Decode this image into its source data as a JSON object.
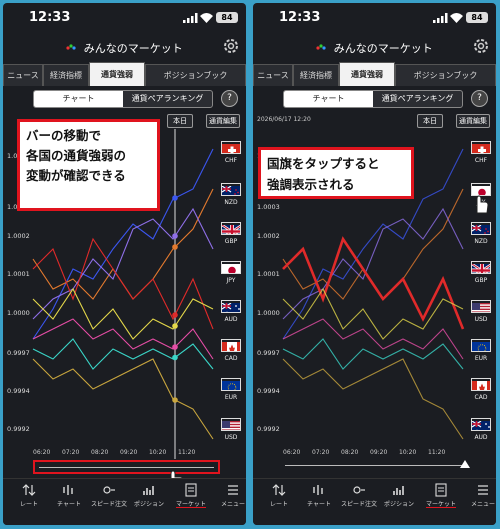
{
  "status": {
    "time": "12:33",
    "battery": "84"
  },
  "app_title": "みんなのマーケット",
  "tabs": [
    "ニュース",
    "経済指標",
    "通貨強弱",
    "ポジションブック"
  ],
  "segment": {
    "chart": "チャート",
    "ranking": "通貨ペアランキング"
  },
  "help_label": "?",
  "toolbar": {
    "today": "本日",
    "edit": "通貨編集"
  },
  "right_datestamp": "2026/06/17 12:20",
  "y_ticks": [
    "1.0005",
    "1.0004",
    "1.0003",
    "1.0002",
    "1.0001",
    "1.0000",
    "0.9997",
    "0.9994",
    "0.9992"
  ],
  "x_ticks": [
    "06:20",
    "07:20",
    "08:20",
    "09:20",
    "10:20",
    "11:20"
  ],
  "currencies": {
    "left": [
      "CHF",
      "NZD",
      "GBP",
      "JPY",
      "AUD",
      "CAD",
      "EUR",
      "USD"
    ],
    "right": [
      "CHF",
      "JPY",
      "NZD",
      "GBP",
      "USD",
      "EUR",
      "CAD",
      "AUD"
    ]
  },
  "callout_left": "バーの移動で\n各国の通貨強弱の\n変動が確認できる",
  "callout_right": "国旗をタップすると\n強調表示される",
  "nav": [
    "レート",
    "チャート",
    "スピード注文",
    "ポジション",
    "マーケット",
    "メニュー"
  ],
  "colors": {
    "CHF": "#3b56f0",
    "NZD": "#e47a2e",
    "GBP": "#8f6fe8",
    "JPY": "#e02a2a",
    "AUD": "#e4d84a",
    "CAD": "#e64da6",
    "EUR": "#3ad6c8",
    "USD": "#c9a63e",
    "accent": "#e0141e"
  }
}
